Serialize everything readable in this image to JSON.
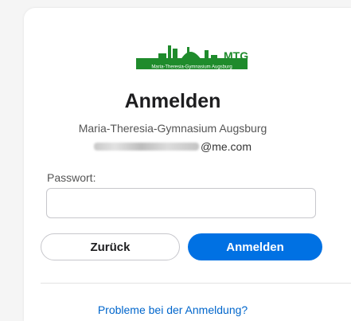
{
  "logo": {
    "text": "MTG",
    "caption": "Maria-Theresia-Gymnasium Augsburg"
  },
  "title": "Anmelden",
  "school": "Maria-Theresia-Gymnasium Augsburg",
  "account": {
    "email_suffix": "@me.com"
  },
  "password": {
    "label": "Passwort:",
    "value": "",
    "placeholder": ""
  },
  "buttons": {
    "back": "Zurück",
    "login": "Anmelden"
  },
  "help_link": "Probleme bei der Anmeldung?",
  "colors": {
    "accent": "#0071e3",
    "logo_green": "#1f8b2c",
    "link": "#0066cc"
  }
}
